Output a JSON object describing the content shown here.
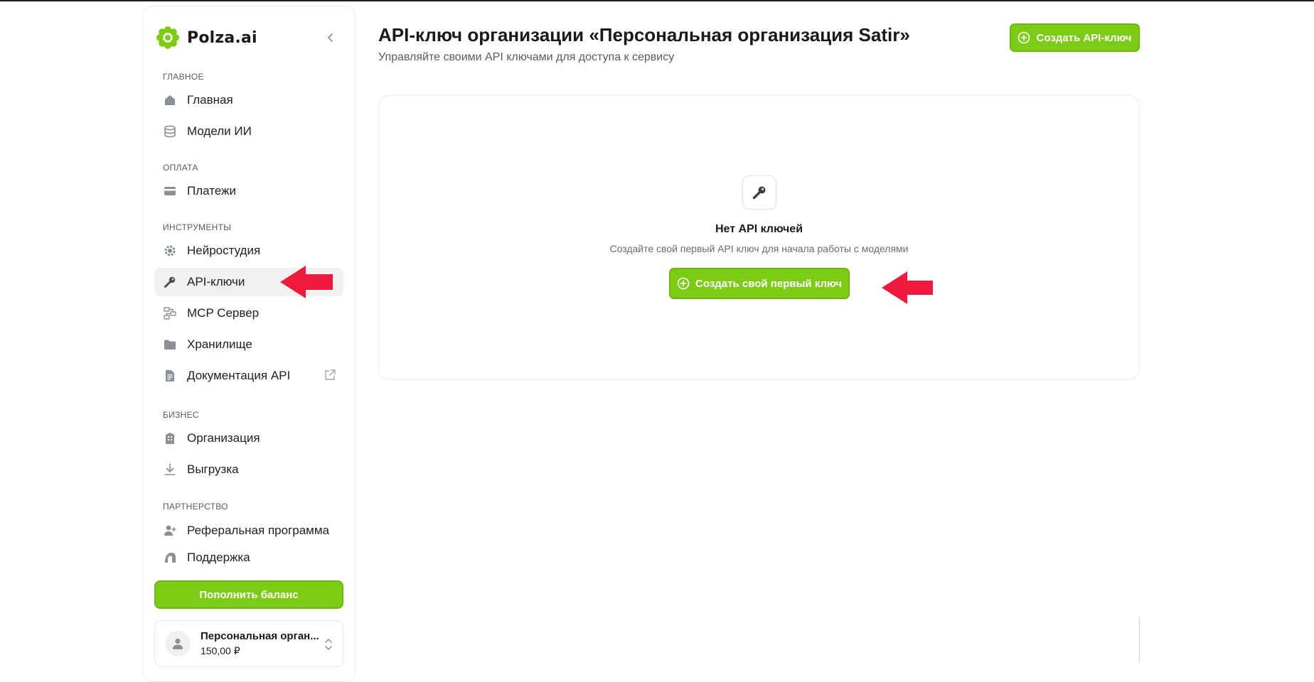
{
  "sidebar": {
    "brand": "Polza.ai",
    "sections": {
      "main": "ГЛАВНОЕ",
      "payment": "ОПЛАТА",
      "tools": "ИНСТРУМЕНТЫ",
      "business": "БИЗНЕС",
      "partnership": "ПАРТНЕРСТВО"
    },
    "items": {
      "home": "Главная",
      "models": "Модели ИИ",
      "payments": "Платежи",
      "studio": "Нейростудия",
      "api_keys": "API-ключи",
      "mcp": "MCP Сервер",
      "storage": "Хранилище",
      "docs": "Документация API",
      "org": "Организация",
      "export": "Выгрузка",
      "referral": "Реферальная программа",
      "support": "Поддержка"
    },
    "active_item": "api_keys",
    "balance_button": "Пополнить баланс",
    "org_card": {
      "name": "Персональная орган...",
      "balance": "150,00 ₽"
    }
  },
  "header": {
    "title": "API-ключ организации «Персональная организация Satir»",
    "subtitle": "Управляйте своими API ключами для доступа к сервису",
    "create_button": "Создать API-ключ"
  },
  "empty_state": {
    "title": "Нет API ключей",
    "description": "Создайте свой первый API ключ для начала работы с моделями",
    "button": "Создать свой первый ключ"
  },
  "colors": {
    "accent": "#7ccb14",
    "annotation_arrow": "#ee1a3c"
  }
}
